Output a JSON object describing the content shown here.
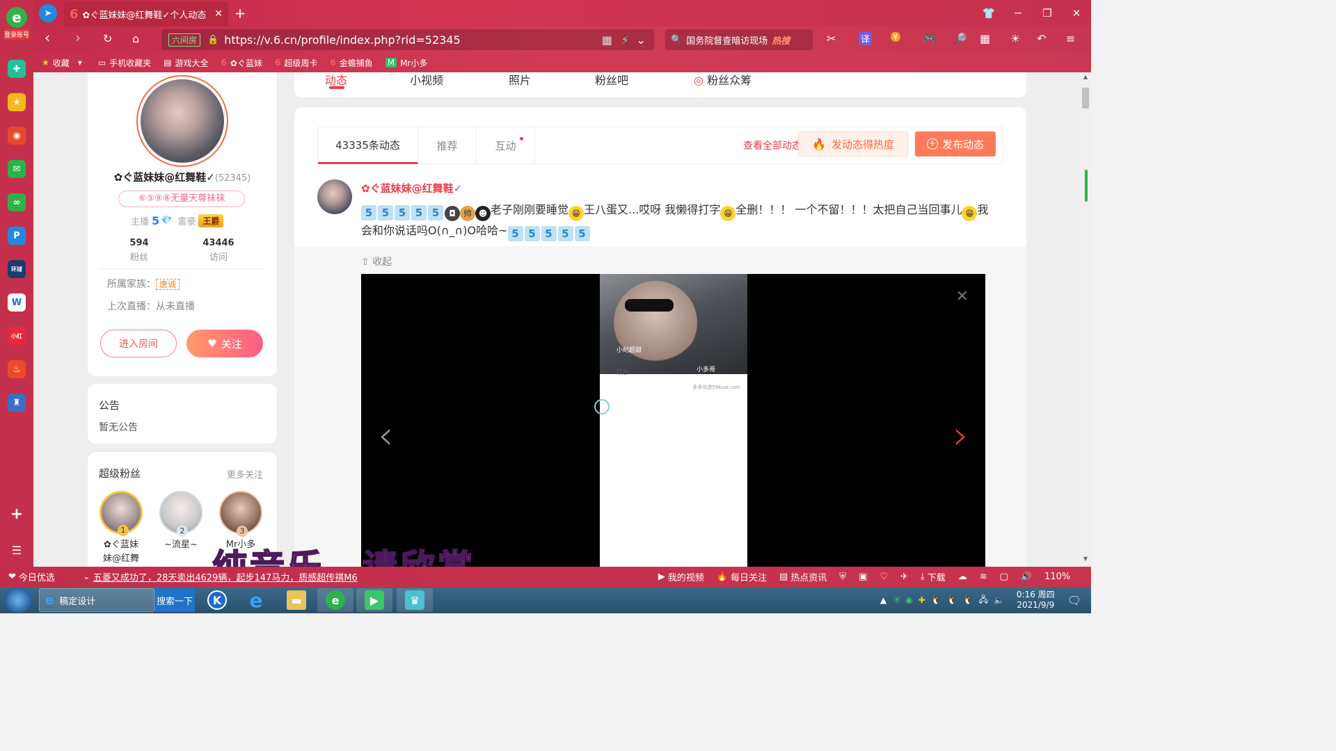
{
  "browser": {
    "tab_title": "✿ぐ蓝妹妹@红舞鞋✓个人动态",
    "url": "https://v.6.cn/profile/index.php?rid=52345",
    "url_tag": "六间房",
    "search_text": "国务院督查暗访现场",
    "search_hot": "热搜",
    "login_label": "登录账号",
    "bookmarks": [
      {
        "icon": "★",
        "label": "收藏"
      },
      {
        "icon": "▭",
        "label": "手机收藏夹"
      },
      {
        "icon": "▤",
        "label": "游戏大全"
      },
      {
        "icon": "6",
        "label": "✿ぐ蓝妹"
      },
      {
        "icon": "6",
        "label": "超级周卡"
      },
      {
        "icon": "6",
        "label": "金蟾捕鱼"
      },
      {
        "icon": "M",
        "label": "Mr小多"
      }
    ]
  },
  "top_tabs": [
    "动态",
    "小视频",
    "照片",
    "粉丝吧",
    "粉丝众筹"
  ],
  "profile": {
    "nickname": "✿ぐ蓝妹妹@红舞鞋✓",
    "rid": "(52345)",
    "badge": "⑥⑤⑨⑧无量天尊袜袜",
    "host_label": "主播",
    "host_level": "5",
    "rich_label": "富豪",
    "rich_badge": "王爵",
    "fans_count": "594",
    "fans_label": "粉丝",
    "visits_count": "43446",
    "visits_label": "访问",
    "family_label": "所属家族：",
    "family_value": "唐诚",
    "last_live": "上次直播：从未直播",
    "enter_room": "进入房间",
    "follow": "关注"
  },
  "notice": {
    "title": "公告",
    "body": "暂无公告"
  },
  "super_fans": {
    "title": "超级粉丝",
    "more": "更多关注",
    "items": [
      {
        "rank": "1",
        "name": "✿ぐ蓝妹\n妹@红舞"
      },
      {
        "rank": "2",
        "name": "~流星~"
      },
      {
        "rank": "3",
        "name": "Mr小多"
      }
    ]
  },
  "feed": {
    "tabs": [
      "43335条动态",
      "推荐",
      "互动"
    ],
    "view_all": "查看全部动态",
    "hot_button": "发动态得热度",
    "post_button": "发布动态",
    "post_author": "✿ぐ蓝妹妹@红舞鞋✓",
    "post_text_1": "老子刚刚要睡觉",
    "post_text_2": "王八蛋又...哎呀 我懒得打字",
    "post_text_3": "全删！！！ 一个不留！！！太把自己当回事儿",
    "post_text_4": "我",
    "post_text_5": "会和你说话吗O(∩_∩)O哈哈~",
    "collapse": "收起",
    "phone_labels": [
      "小纪超甜",
      "小多哥",
      "软乎",
      "多多优选59kuai.com"
    ]
  },
  "overlay_subtitle": "纯音乐，请欣赏",
  "newsbar": {
    "today": "今日优选",
    "ticker": "五菱又成功了，28天卖出4629辆，起步147马力，质感超传祺M6",
    "my_video": "我的视频",
    "daily": "每日关注",
    "hot_news": "热点资讯",
    "download": "下载",
    "zoom": "110%"
  },
  "taskbar": {
    "ie_title": "稿定设计",
    "search": "搜索一下",
    "time": "0:16 周四",
    "date": "2021/9/9"
  },
  "colors": {
    "accent": "#ea3d4c",
    "chrome": "#c62f4c"
  }
}
